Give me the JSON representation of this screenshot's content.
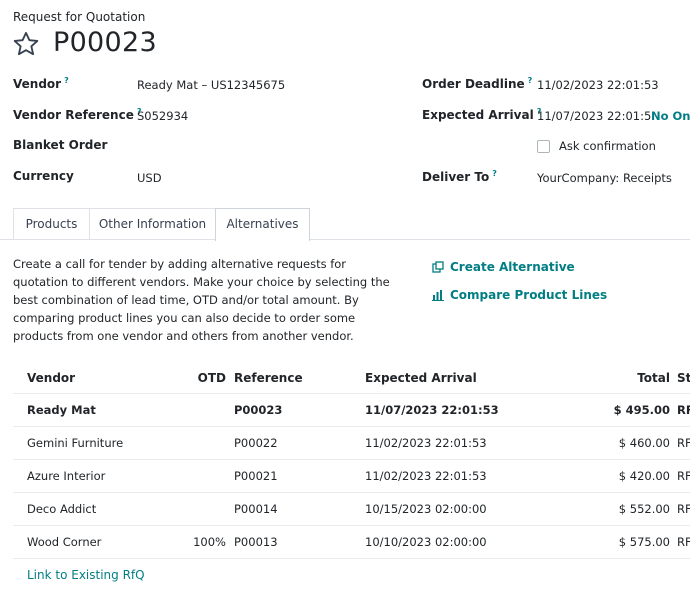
{
  "header": {
    "subtitle": "Request for Quotation",
    "title": "P00023"
  },
  "fields": {
    "vendor": {
      "label": "Vendor",
      "value": "Ready Mat – US12345675"
    },
    "vendor_reference": {
      "label": "Vendor Reference",
      "value": "S052934"
    },
    "blanket_order": {
      "label": "Blanket Order"
    },
    "currency": {
      "label": "Currency",
      "value": "USD"
    },
    "order_deadline": {
      "label": "Order Deadline",
      "value": "11/02/2023 22:01:53"
    },
    "expected_arrival": {
      "label": "Expected Arrival",
      "value": "11/07/2023 22:01:5",
      "badge": "No On-"
    },
    "ask_confirmation": {
      "label": "Ask confirmation",
      "checked": false
    },
    "deliver_to": {
      "label": "Deliver To",
      "value": "YourCompany: Receipts"
    },
    "help_mark": "?"
  },
  "tabs": [
    {
      "label": "Products"
    },
    {
      "label": "Other Information"
    },
    {
      "label": "Alternatives",
      "active": true
    }
  ],
  "alternatives": {
    "description": "Create a call for tender by adding alternative requests for quotation to different vendors. Make your choice by selecting the best combination of lead time, OTD and/or total amount. By comparing product lines you can also decide to order some products from one vendor and others from another vendor.",
    "create_alternative": "Create Alternative",
    "compare_lines": "Compare Product Lines",
    "columns": {
      "vendor": "Vendor",
      "otd": "OTD",
      "reference": "Reference",
      "expected_arrival": "Expected Arrival",
      "total": "Total",
      "status": "St"
    },
    "rows": [
      {
        "vendor": "Ready Mat",
        "otd": "",
        "reference": "P00023",
        "arrival": "11/07/2023 22:01:53",
        "total": "$ 495.00",
        "status": "RF"
      },
      {
        "vendor": "Gemini Furniture",
        "otd": "",
        "reference": "P00022",
        "arrival": "11/02/2023 22:01:53",
        "total": "$ 460.00",
        "status": "RF"
      },
      {
        "vendor": "Azure Interior",
        "otd": "",
        "reference": "P00021",
        "arrival": "11/02/2023 22:01:53",
        "total": "$ 420.00",
        "status": "RF"
      },
      {
        "vendor": "Deco Addict",
        "otd": "",
        "reference": "P00014",
        "arrival": "10/15/2023 02:00:00",
        "total": "$ 552.00",
        "status": "RF"
      },
      {
        "vendor": "Wood Corner",
        "otd": "100%",
        "reference": "P00013",
        "arrival": "10/10/2023 02:00:00",
        "total": "$ 575.00",
        "status": "RF"
      }
    ],
    "link_existing": "Link to Existing RfQ"
  },
  "colors": {
    "accent": "#017e84",
    "text": "#212529",
    "border": "#dee2e6"
  }
}
